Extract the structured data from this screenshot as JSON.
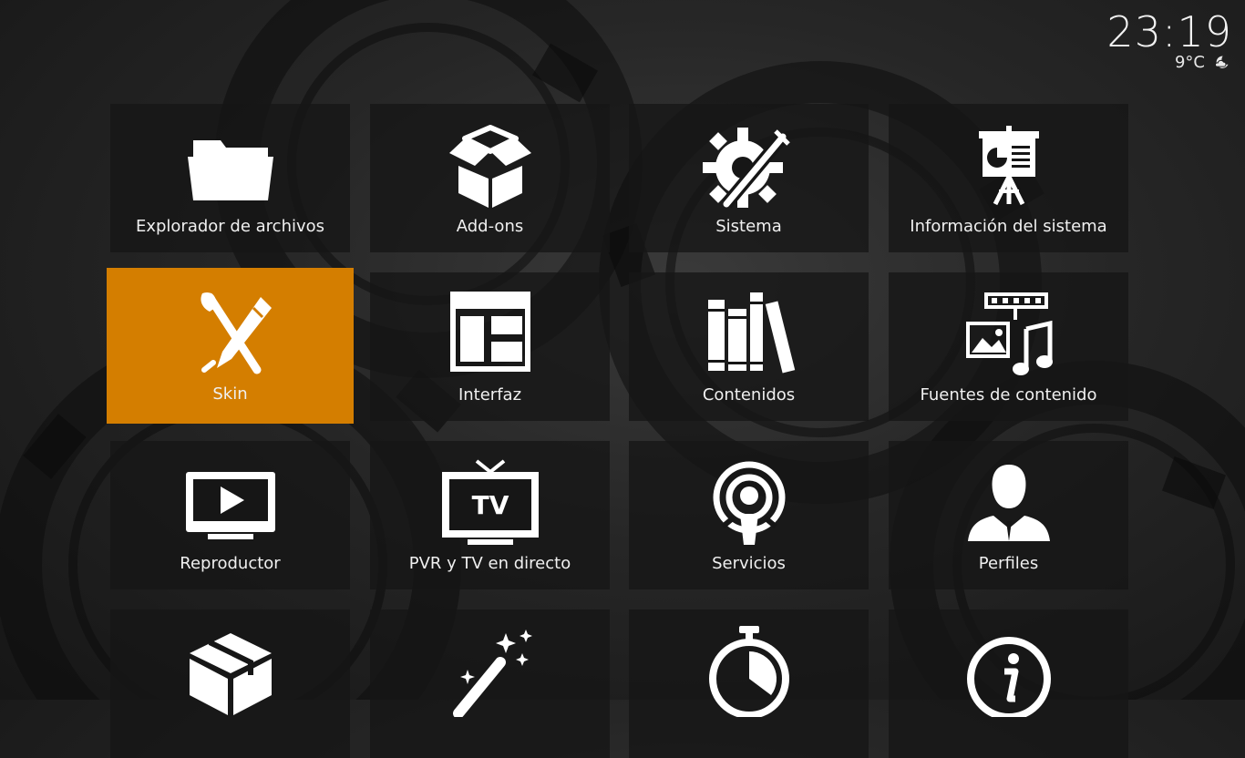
{
  "clock": {
    "time": "23:19"
  },
  "weather": {
    "temperature": "9°C",
    "icon": "moon-cloud-icon"
  },
  "accent_color": "#d47e00",
  "tiles": [
    {
      "label": "Explorador de archivos",
      "icon": "folder-icon",
      "focused": false
    },
    {
      "label": "Add-ons",
      "icon": "open-box-icon",
      "focused": false
    },
    {
      "label": "Sistema",
      "icon": "gear-tools-icon",
      "focused": false
    },
    {
      "label": "Información del sistema",
      "icon": "presentation-icon",
      "focused": false
    },
    {
      "label": "Skin",
      "icon": "brush-pen-icon",
      "focused": true
    },
    {
      "label": "Interfaz",
      "icon": "layout-icon",
      "focused": false
    },
    {
      "label": "Contenidos",
      "icon": "books-icon",
      "focused": false
    },
    {
      "label": "Fuentes de contenido",
      "icon": "media-sources-icon",
      "focused": false
    },
    {
      "label": "Reproductor",
      "icon": "play-monitor-icon",
      "focused": false
    },
    {
      "label": "PVR y TV en directo",
      "icon": "tv-icon",
      "focused": false
    },
    {
      "label": "Servicios",
      "icon": "broadcast-icon",
      "focused": false
    },
    {
      "label": "Perfiles",
      "icon": "user-profile-icon",
      "focused": false
    },
    {
      "label": "",
      "icon": "package-icon",
      "focused": false
    },
    {
      "label": "",
      "icon": "magic-wand-icon",
      "focused": false
    },
    {
      "label": "",
      "icon": "stopwatch-icon",
      "focused": false
    },
    {
      "label": "",
      "icon": "info-icon",
      "focused": false
    }
  ]
}
